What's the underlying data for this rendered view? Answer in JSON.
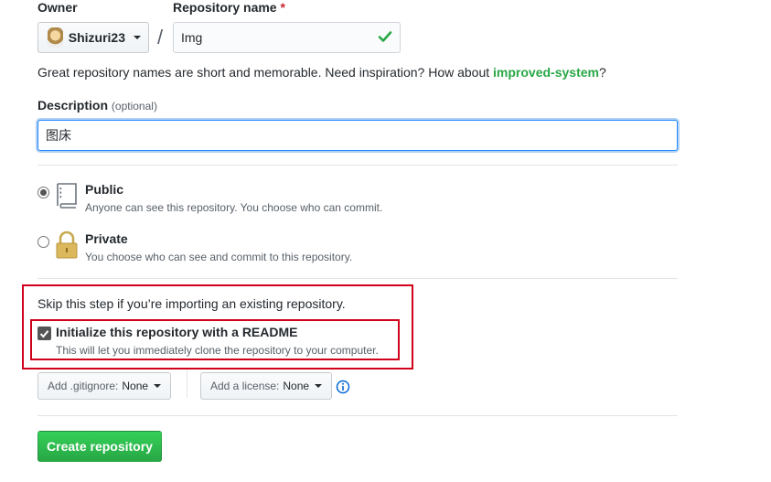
{
  "owner": {
    "label": "Owner",
    "value": "Shizuri23"
  },
  "repo_name": {
    "label": "Repository name",
    "required_mark": "*",
    "value": "Img"
  },
  "hint": {
    "text": "Great repository names are short and memorable. Need inspiration? How about ",
    "suggestion": "improved-system",
    "end": "?"
  },
  "description": {
    "label": "Description",
    "optional": "(optional)",
    "value": "图床"
  },
  "visibility": {
    "public": {
      "title": "Public",
      "note": "Anyone can see this repository. You choose who can commit."
    },
    "private": {
      "title": "Private",
      "note": "You choose who can see and commit to this repository."
    }
  },
  "init": {
    "skip_text": "Skip this step if you’re importing an existing repository.",
    "readme_label": "Initialize this repository with a README",
    "readme_note": "This will let you immediately clone the repository to your computer."
  },
  "gitignore": {
    "label": "Add .gitignore:",
    "value": "None"
  },
  "license": {
    "label": "Add a license:",
    "value": "None"
  },
  "create_button": "Create repository",
  "colors": {
    "highlight": "#d0021b",
    "primary": "#28a745",
    "focus": "#2188ff"
  }
}
